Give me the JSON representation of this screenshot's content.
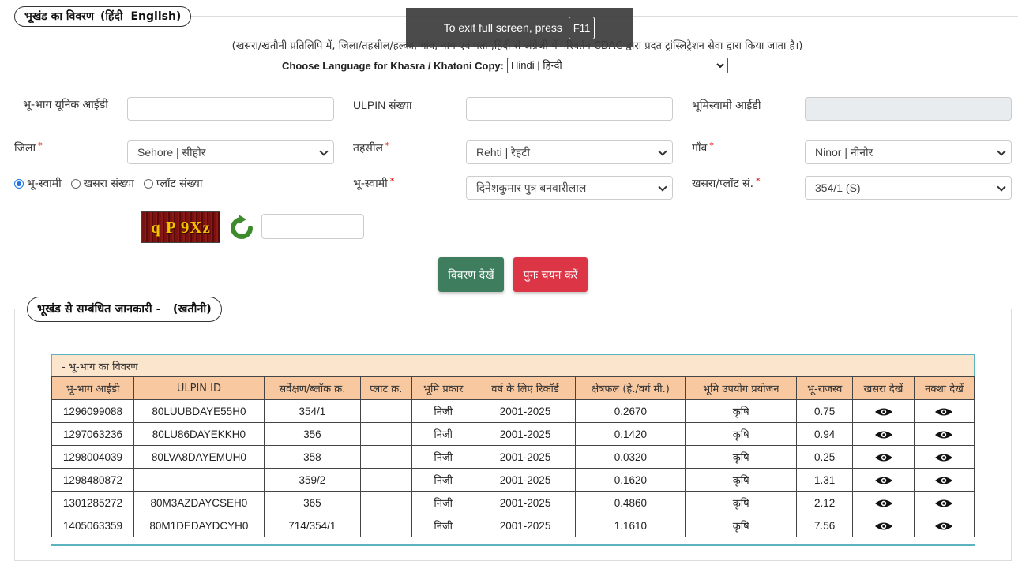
{
  "section1": {
    "legend_title": "भूखंड का विवरण",
    "legend_hindi": "(हिंदी",
    "legend_english": "English)",
    "note": "(खसरा/खतौनी प्रतिलिपि में, जिला/तहसील/हल्का, गांव, नाम एवं पता ,हिंदी से अंग्रेजी में परिवर्तन CDAC द्वारा प्रदत ट्रांस्लिट्रेशन सेवा द्वारा किया जाता है।)",
    "lang_label": "Choose Language for Khasra / Khatoni Copy:",
    "lang_value": "Hindi | हिन्दी",
    "fields": {
      "unique_id_label": "भू-भाग यूनिक आईडी",
      "ulpin_label": "ULPIN संख्या",
      "owner_id_label": "भूमिस्वामी आईडी",
      "district_label": "जिला",
      "district_value": "Sehore | सीहोर",
      "tehsil_label": "तहसील",
      "tehsil_value": "Rehti | रेहटी",
      "village_label": "गाँव",
      "village_value": "Ninor | नीनोर",
      "owner_label": "भू-स्वामी",
      "owner_value": "दिनेशकुमार पुत्र बनवारीलाल",
      "khasra_label": "खसरा/प्लॉट सं.",
      "khasra_value": "354/1 (S)",
      "required_mark": "*"
    },
    "radios": [
      {
        "label": "भू-स्वामी",
        "checked": true
      },
      {
        "label": "खसरा संख्या",
        "checked": false
      },
      {
        "label": "प्लॉट संख्या",
        "checked": false
      }
    ],
    "captcha_text": "q P 9Xz",
    "buttons": {
      "view": "विवरण देखें",
      "reset": "पुनः चयन करें"
    }
  },
  "section2": {
    "legend": "भूखंड से सम्बंधित जानकारी -   (खतौनी)",
    "panel_title": "- भू-भाग का विवरण",
    "columns": [
      "भू-भाग आईडी",
      "ULPIN ID",
      "सर्वेक्षण/ब्लॉक क्र.",
      "प्लाट क्र.",
      "भूमि प्रकार",
      "वर्ष के लिए रिकॉर्ड",
      "क्षेत्रफल (हे./वर्ग मी.)",
      "भूमि उपयोग प्रयोजन",
      "भू-राजस्व",
      "खसरा देखें",
      "नक्शा देखें"
    ],
    "rows": [
      [
        "1296099088",
        "80LUUBDAYE55H0",
        "354/1",
        "",
        "निजी",
        "2001-2025",
        "0.2670",
        "कृषि",
        "0.75"
      ],
      [
        "1297063236",
        "80LU86DAYEKKH0",
        "356",
        "",
        "निजी",
        "2001-2025",
        "0.1420",
        "कृषि",
        "0.94"
      ],
      [
        "1298004039",
        "80LVA8DAYEMUH0",
        "358",
        "",
        "निजी",
        "2001-2025",
        "0.0320",
        "कृषि",
        "0.25"
      ],
      [
        "1298480872",
        "",
        "359/2",
        "",
        "निजी",
        "2001-2025",
        "0.1620",
        "कृषि",
        "1.31"
      ],
      [
        "1301285272",
        "80M3AZDAYCSEH0",
        "365",
        "",
        "निजी",
        "2001-2025",
        "0.4860",
        "कृषि",
        "2.12"
      ],
      [
        "1405063359",
        "80M1DEDAYDCYH0",
        "714/354/1",
        "",
        "निजी",
        "2001-2025",
        "1.1610",
        "कृषि",
        "7.56"
      ]
    ]
  },
  "toast": {
    "text": "To exit full screen, press",
    "key": "F11"
  },
  "colors": {
    "view_button": "#3e7e5e",
    "reset_button": "#dc3545",
    "table_header": "#f8c8a0",
    "panel_header": "#fce5cd"
  }
}
